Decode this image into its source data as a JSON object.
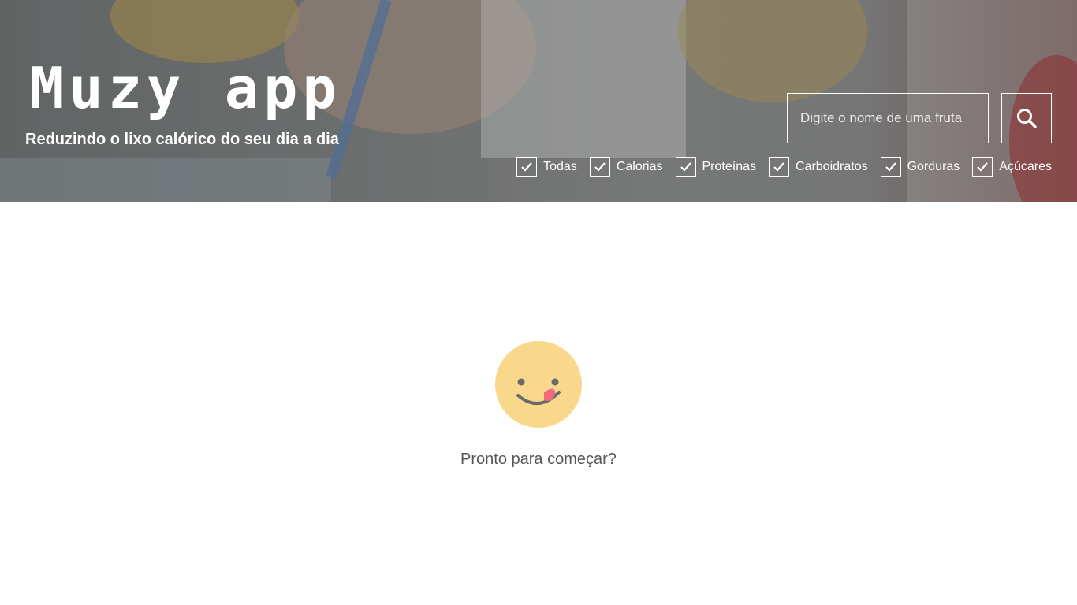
{
  "header": {
    "logo_text": "Muzy app",
    "tagline": "Reduzindo o lixo calórico do seu dia a dia"
  },
  "search": {
    "placeholder": "Digite o nome de uma fruta",
    "button_icon": "search-icon"
  },
  "filters": [
    {
      "label": "Todas",
      "checked": true
    },
    {
      "label": "Calorias",
      "checked": true
    },
    {
      "label": "Proteínas",
      "checked": true
    },
    {
      "label": "Carboidratos",
      "checked": true
    },
    {
      "label": "Gorduras",
      "checked": true
    },
    {
      "label": "Açúcares",
      "checked": true
    }
  ],
  "empty_state": {
    "icon": "smiley-tongue-icon",
    "message": "Pronto para começar?"
  },
  "colors": {
    "smiley_face": "#f9d78b",
    "smiley_tongue": "#ef6b7d",
    "text_muted": "#555555",
    "hero_text": "#ffffff"
  }
}
